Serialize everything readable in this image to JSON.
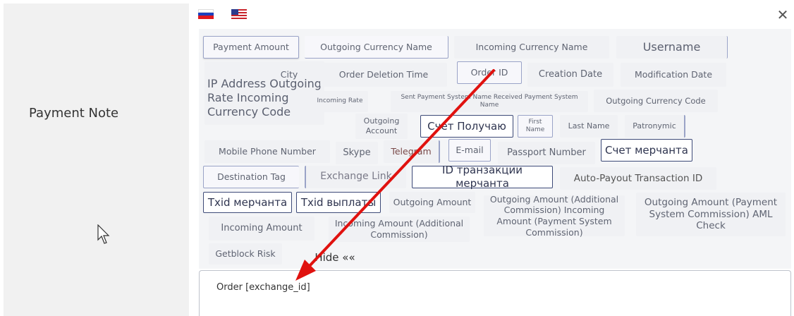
{
  "field_label": "Payment Note",
  "textarea_value": "Order [exchange_id]",
  "hide_button": "Hide ««",
  "tags": {
    "payment_amount": "Payment Amount",
    "outgoing_currency_name": "Outgoing Currency Name",
    "incoming_currency_name": "Incoming Currency Name",
    "username": "Username",
    "ip_address_outgoing_rate_incoming_currency_code": "IP Address Outgoing Rate Incoming Currency Code",
    "city": "City",
    "order_deletion_time": "Order Deletion Time",
    "order_id": "Order ID",
    "creation_date": "Creation Date",
    "modification_date": "Modification Date",
    "incoming_rate": "Incoming Rate",
    "sent_received_ps_name": "Sent Payment System Name Received Payment System Name",
    "outgoing_currency_code": "Outgoing Currency Code",
    "outgoing_account": "Outgoing Account",
    "schet_poluchayu": "Счет Получаю",
    "first_name": "First Name",
    "last_name": "Last Name",
    "patronymic": "Patronymic",
    "mobile_phone_number": "Mobile Phone Number",
    "skype": "Skype",
    "telegram": "Telegram",
    "email": "E-mail",
    "passport_number": "Passport Number",
    "schet_merchanta": "Счет мерчанта",
    "destination_tag": "Destination Tag",
    "exchange_link": "Exchange Link",
    "id_transaktsii_merchanta": "ID транзакции мерчанта",
    "auto_payout_transaction_id": "Auto-Payout Transaction ID",
    "txid_merchanta": "Txid мерчанта",
    "txid_vyplaty": "Txid выплаты",
    "outgoing_amount": "Outgoing Amount",
    "outgoing_additional_incoming_ps": "Outgoing Amount (Additional Commission) Incoming Amount (Payment System Commission)",
    "outgoing_ps_aml": "Outgoing Amount (Payment System Commission) AML Check",
    "incoming_amount": "Incoming Amount",
    "incoming_amount_additional": "Incoming Amount (Additional Commission)",
    "getblock_risk": "Getblock Risk"
  },
  "icons": {
    "flag_ru": "russia-flag-icon",
    "flag_us": "usa-flag-icon",
    "close": "close-icon",
    "cursor": "mouse-pointer-icon",
    "arrow": "red-arrow-annotation"
  },
  "colors": {
    "arrow": "#e0120f",
    "tag_border": "#9aa3c7",
    "dark_tag_border": "#3d4a78"
  }
}
